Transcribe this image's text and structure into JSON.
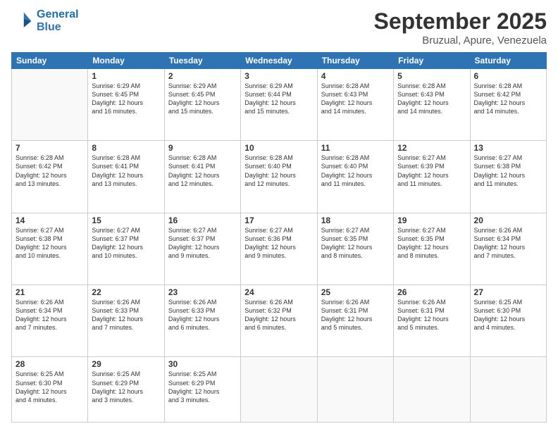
{
  "logo": {
    "line1": "General",
    "line2": "Blue"
  },
  "title": "September 2025",
  "location": "Bruzual, Apure, Venezuela",
  "weekdays": [
    "Sunday",
    "Monday",
    "Tuesday",
    "Wednesday",
    "Thursday",
    "Friday",
    "Saturday"
  ],
  "weeks": [
    [
      {
        "day": "",
        "info": ""
      },
      {
        "day": "1",
        "info": "Sunrise: 6:29 AM\nSunset: 6:45 PM\nDaylight: 12 hours\nand 16 minutes."
      },
      {
        "day": "2",
        "info": "Sunrise: 6:29 AM\nSunset: 6:45 PM\nDaylight: 12 hours\nand 15 minutes."
      },
      {
        "day": "3",
        "info": "Sunrise: 6:29 AM\nSunset: 6:44 PM\nDaylight: 12 hours\nand 15 minutes."
      },
      {
        "day": "4",
        "info": "Sunrise: 6:28 AM\nSunset: 6:43 PM\nDaylight: 12 hours\nand 14 minutes."
      },
      {
        "day": "5",
        "info": "Sunrise: 6:28 AM\nSunset: 6:43 PM\nDaylight: 12 hours\nand 14 minutes."
      },
      {
        "day": "6",
        "info": "Sunrise: 6:28 AM\nSunset: 6:42 PM\nDaylight: 12 hours\nand 14 minutes."
      }
    ],
    [
      {
        "day": "7",
        "info": "Sunrise: 6:28 AM\nSunset: 6:42 PM\nDaylight: 12 hours\nand 13 minutes."
      },
      {
        "day": "8",
        "info": "Sunrise: 6:28 AM\nSunset: 6:41 PM\nDaylight: 12 hours\nand 13 minutes."
      },
      {
        "day": "9",
        "info": "Sunrise: 6:28 AM\nSunset: 6:41 PM\nDaylight: 12 hours\nand 12 minutes."
      },
      {
        "day": "10",
        "info": "Sunrise: 6:28 AM\nSunset: 6:40 PM\nDaylight: 12 hours\nand 12 minutes."
      },
      {
        "day": "11",
        "info": "Sunrise: 6:28 AM\nSunset: 6:40 PM\nDaylight: 12 hours\nand 11 minutes."
      },
      {
        "day": "12",
        "info": "Sunrise: 6:27 AM\nSunset: 6:39 PM\nDaylight: 12 hours\nand 11 minutes."
      },
      {
        "day": "13",
        "info": "Sunrise: 6:27 AM\nSunset: 6:38 PM\nDaylight: 12 hours\nand 11 minutes."
      }
    ],
    [
      {
        "day": "14",
        "info": "Sunrise: 6:27 AM\nSunset: 6:38 PM\nDaylight: 12 hours\nand 10 minutes."
      },
      {
        "day": "15",
        "info": "Sunrise: 6:27 AM\nSunset: 6:37 PM\nDaylight: 12 hours\nand 10 minutes."
      },
      {
        "day": "16",
        "info": "Sunrise: 6:27 AM\nSunset: 6:37 PM\nDaylight: 12 hours\nand 9 minutes."
      },
      {
        "day": "17",
        "info": "Sunrise: 6:27 AM\nSunset: 6:36 PM\nDaylight: 12 hours\nand 9 minutes."
      },
      {
        "day": "18",
        "info": "Sunrise: 6:27 AM\nSunset: 6:35 PM\nDaylight: 12 hours\nand 8 minutes."
      },
      {
        "day": "19",
        "info": "Sunrise: 6:27 AM\nSunset: 6:35 PM\nDaylight: 12 hours\nand 8 minutes."
      },
      {
        "day": "20",
        "info": "Sunrise: 6:26 AM\nSunset: 6:34 PM\nDaylight: 12 hours\nand 7 minutes."
      }
    ],
    [
      {
        "day": "21",
        "info": "Sunrise: 6:26 AM\nSunset: 6:34 PM\nDaylight: 12 hours\nand 7 minutes."
      },
      {
        "day": "22",
        "info": "Sunrise: 6:26 AM\nSunset: 6:33 PM\nDaylight: 12 hours\nand 7 minutes."
      },
      {
        "day": "23",
        "info": "Sunrise: 6:26 AM\nSunset: 6:33 PM\nDaylight: 12 hours\nand 6 minutes."
      },
      {
        "day": "24",
        "info": "Sunrise: 6:26 AM\nSunset: 6:32 PM\nDaylight: 12 hours\nand 6 minutes."
      },
      {
        "day": "25",
        "info": "Sunrise: 6:26 AM\nSunset: 6:31 PM\nDaylight: 12 hours\nand 5 minutes."
      },
      {
        "day": "26",
        "info": "Sunrise: 6:26 AM\nSunset: 6:31 PM\nDaylight: 12 hours\nand 5 minutes."
      },
      {
        "day": "27",
        "info": "Sunrise: 6:25 AM\nSunset: 6:30 PM\nDaylight: 12 hours\nand 4 minutes."
      }
    ],
    [
      {
        "day": "28",
        "info": "Sunrise: 6:25 AM\nSunset: 6:30 PM\nDaylight: 12 hours\nand 4 minutes."
      },
      {
        "day": "29",
        "info": "Sunrise: 6:25 AM\nSunset: 6:29 PM\nDaylight: 12 hours\nand 3 minutes."
      },
      {
        "day": "30",
        "info": "Sunrise: 6:25 AM\nSunset: 6:29 PM\nDaylight: 12 hours\nand 3 minutes."
      },
      {
        "day": "",
        "info": ""
      },
      {
        "day": "",
        "info": ""
      },
      {
        "day": "",
        "info": ""
      },
      {
        "day": "",
        "info": ""
      }
    ]
  ]
}
